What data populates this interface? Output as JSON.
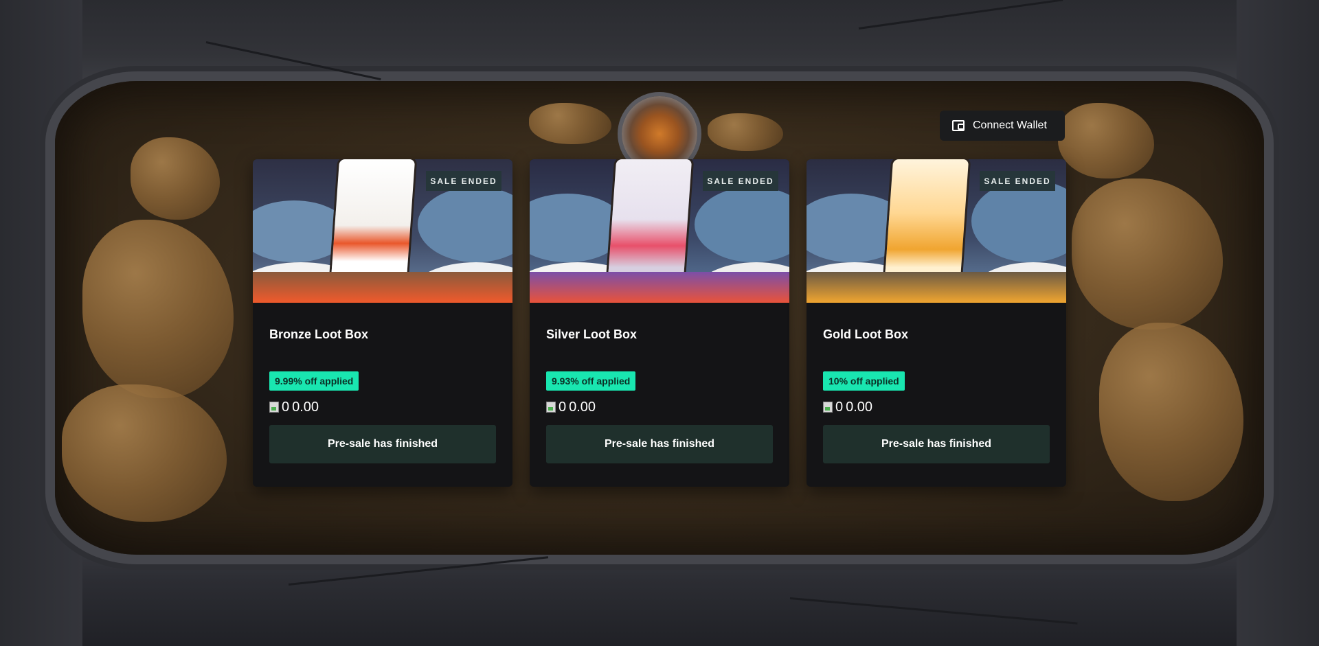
{
  "header": {
    "connect_wallet_label": "Connect Wallet",
    "wallet_icon": "wallet-icon"
  },
  "cards": [
    {
      "title": "Bronze Loot Box",
      "badge": "SALE ENDED",
      "discount": "9.99% off applied",
      "price_prefix": "0",
      "price": "0.00",
      "button": "Pre-sale has finished",
      "accent": "#f05a2c"
    },
    {
      "title": "Silver Loot Box",
      "badge": "SALE ENDED",
      "discount": "9.93% off applied",
      "price_prefix": "0",
      "price": "0.00",
      "button": "Pre-sale has finished",
      "accent": "#e8506a"
    },
    {
      "title": "Gold Loot Box",
      "badge": "SALE ENDED",
      "discount": "10% off applied",
      "price_prefix": "0",
      "price": "0.00",
      "button": "Pre-sale has finished",
      "accent": "#f0a530"
    }
  ],
  "colors": {
    "discount_bg": "#19e6b0",
    "button_bg": "#1f302c",
    "card_bg": "#141416",
    "badge_bg": "#26363a"
  }
}
